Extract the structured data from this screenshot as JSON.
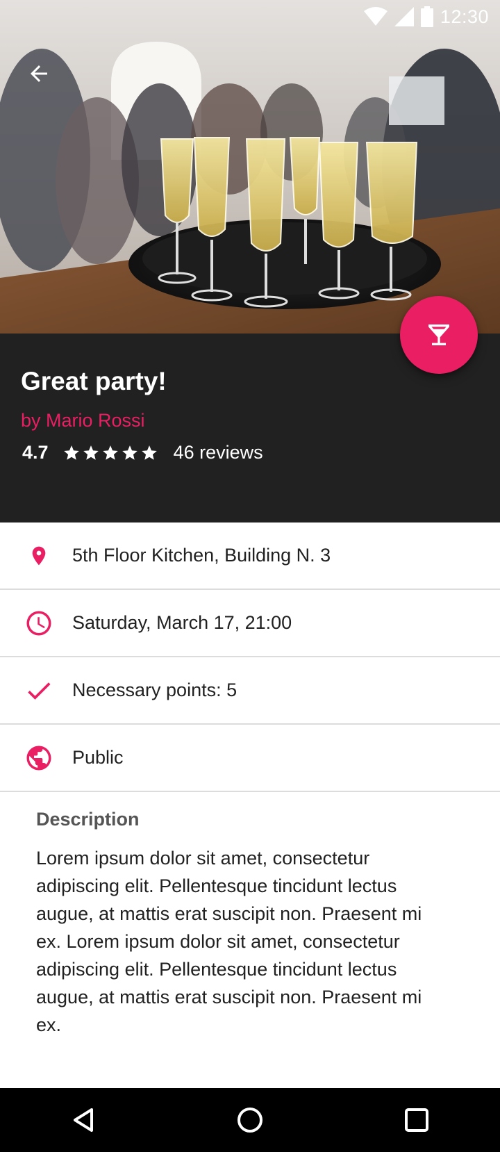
{
  "status_bar": {
    "time": "12:30",
    "icons": [
      "wifi-icon",
      "cellular-signal-icon",
      "battery-icon"
    ]
  },
  "toolbar": {
    "back_icon": "arrow-back-icon"
  },
  "hero": {
    "image_subject": "champagne glasses on a tray at a party"
  },
  "fab": {
    "icon": "cocktail-glass-icon",
    "color": "#e91e63"
  },
  "event": {
    "title": "Great party!",
    "author": "by Mario Rossi",
    "rating": "4.7",
    "stars": 5,
    "reviews": "46 reviews"
  },
  "details": [
    {
      "icon": "location-pin-icon",
      "text": "5th Floor Kitchen, Building N. 3"
    },
    {
      "icon": "clock-icon",
      "text": "Saturday, March 17, 21:00"
    },
    {
      "icon": "checkmark-icon",
      "text": "Necessary points: 5"
    },
    {
      "icon": "globe-icon",
      "text": "Public"
    }
  ],
  "description": {
    "heading": "Description",
    "body": "Lorem ipsum dolor sit amet, consectetur adipiscing elit. Pellentesque tincidunt lectus augue, at mattis erat suscipit non. Praesent mi ex. Lorem ipsum dolor sit amet, consectetur adipiscing elit. Pellentesque tincidunt lectus augue, at mattis erat suscipit non. Praesent mi ex."
  },
  "nav_bar": {
    "buttons": [
      "back-triangle-icon",
      "home-circle-icon",
      "recents-square-icon"
    ]
  },
  "colors": {
    "accent": "#e91e63",
    "header_bg": "#212121",
    "nav_bg": "#000000"
  }
}
